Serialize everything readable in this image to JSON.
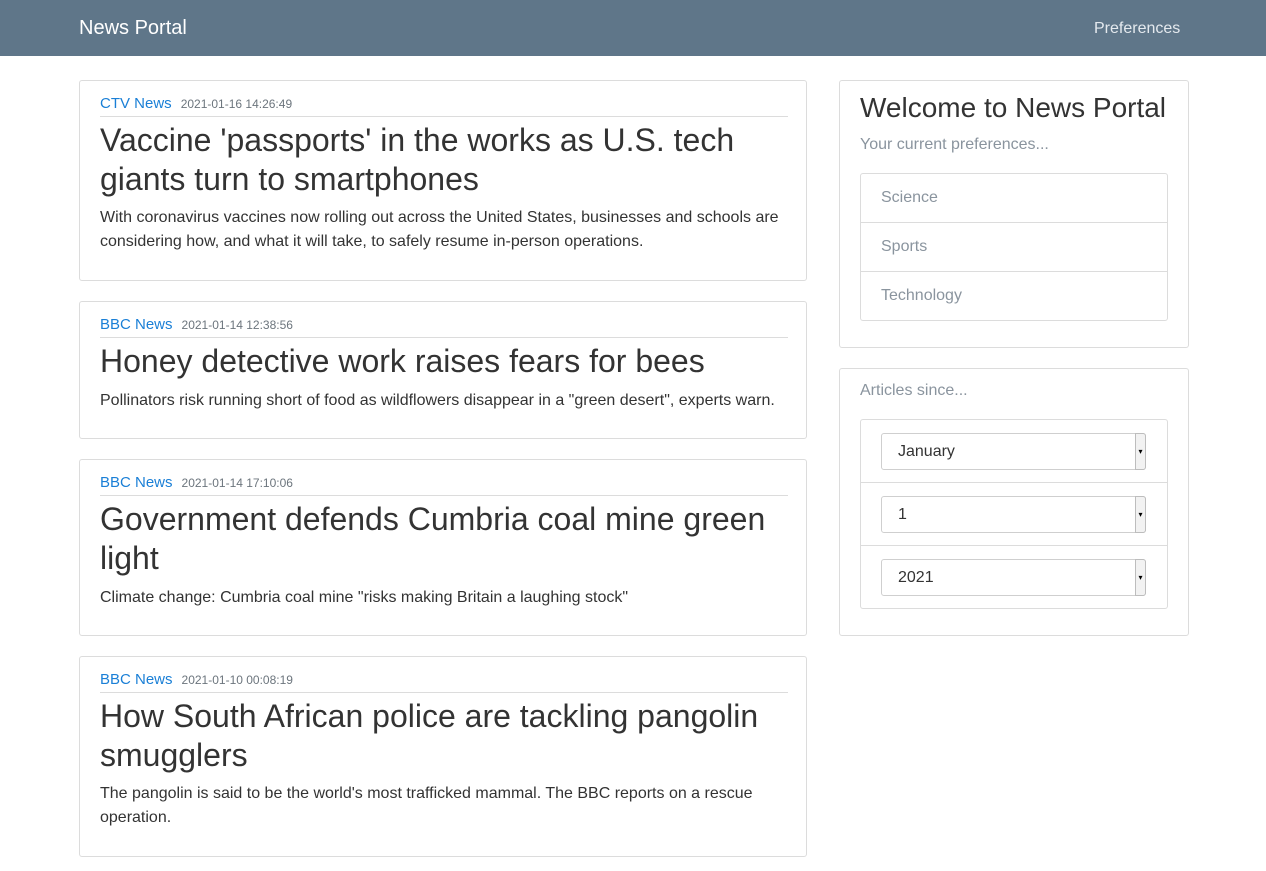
{
  "navbar": {
    "brand": "News Portal",
    "preferences_link": "Preferences"
  },
  "articles": [
    {
      "source": "CTV News",
      "date": "2021-01-16 14:26:49",
      "headline": "Vaccine 'passports' in the works as U.S. tech giants turn to smartphones",
      "summary": "With coronavirus vaccines now rolling out across the United States, businesses and schools are considering how, and what it will take, to safely resume in-person operations."
    },
    {
      "source": "BBC News",
      "date": "2021-01-14 12:38:56",
      "headline": "Honey detective work raises fears for bees",
      "summary": "Pollinators risk running short of food as wildflowers disappear in a \"green desert\", experts warn."
    },
    {
      "source": "BBC News",
      "date": "2021-01-14 17:10:06",
      "headline": "Government defends Cumbria coal mine green light",
      "summary": "Climate change: Cumbria coal mine \"risks making Britain a laughing stock\""
    },
    {
      "source": "BBC News",
      "date": "2021-01-10 00:08:19",
      "headline": "How South African police are tackling pangolin smugglers",
      "summary": "The pangolin is said to be the world's most trafficked mammal. The BBC reports on a rescue operation."
    }
  ],
  "welcome_panel": {
    "title": "Welcome to News Portal",
    "subtitle": "Your current preferences...",
    "preferences": [
      "Science",
      "Sports",
      "Technology"
    ]
  },
  "since_panel": {
    "label": "Articles since...",
    "month": "January",
    "day": "1",
    "year": "2021"
  },
  "colors": {
    "navbar": "#5f7689",
    "link": "#1a7fd6",
    "muted": "#8a949e"
  },
  "icons": {
    "select_arrow": "chevron-down-icon"
  }
}
